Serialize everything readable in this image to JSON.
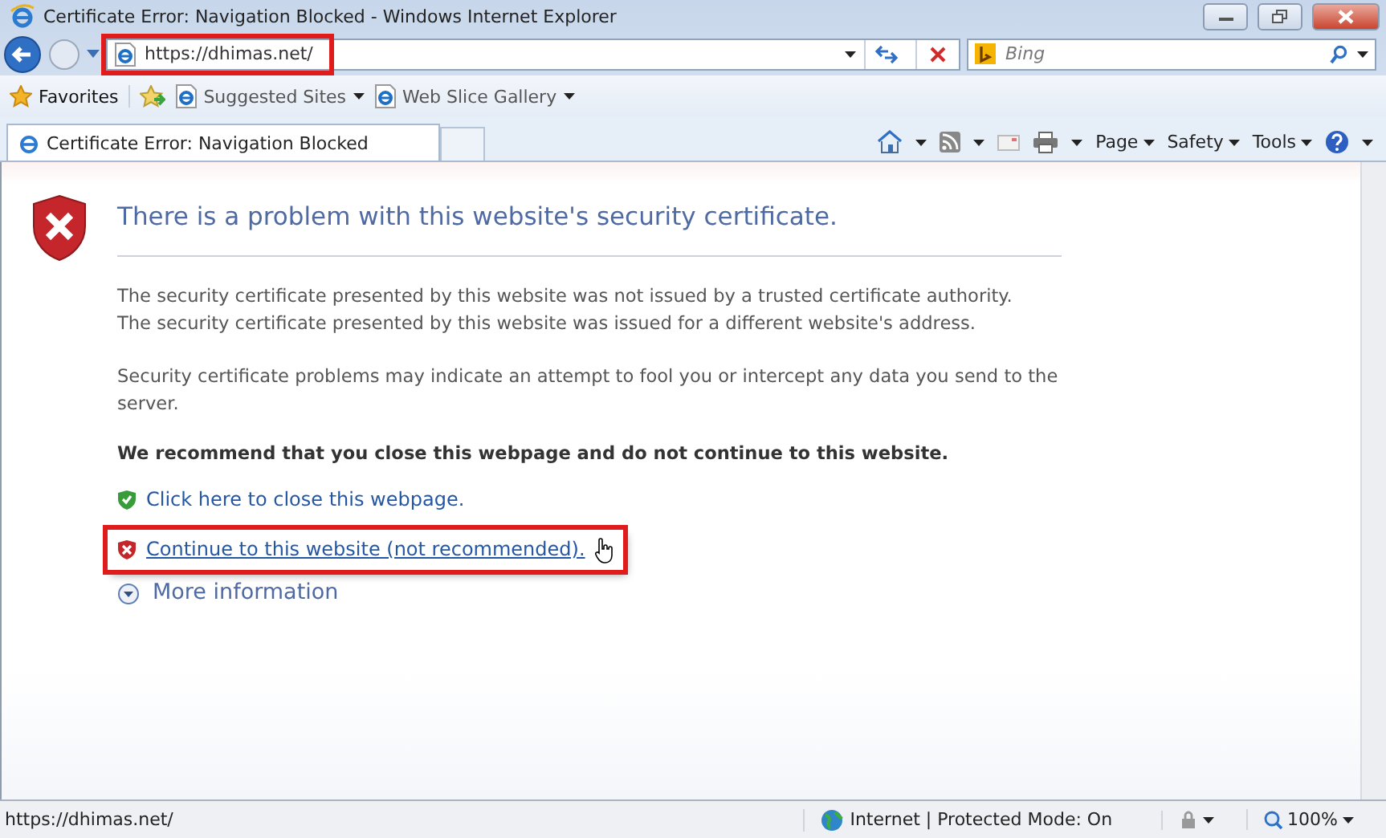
{
  "window": {
    "title": "Certificate Error: Navigation Blocked - Windows Internet Explorer"
  },
  "address_bar": {
    "value": "https://dhimas.net/",
    "highlighted": true
  },
  "search": {
    "placeholder": "Bing"
  },
  "favorites_bar": {
    "items": [
      {
        "label": "Favorites",
        "kind": "star"
      },
      {
        "label": "Suggested Sites",
        "kind": "page"
      },
      {
        "label": "Web Slice Gallery",
        "kind": "page"
      }
    ]
  },
  "tabs": [
    {
      "label": "Certificate Error: Navigation Blocked",
      "selected": true
    }
  ],
  "command_bar": {
    "menus": [
      "Page",
      "Safety",
      "Tools"
    ]
  },
  "content": {
    "heading": "There is a problem with this website's security certificate.",
    "reasons": [
      "The security certificate presented by this website was not issued by a trusted certificate authority.",
      "The security certificate presented by this website was issued for a different website's address."
    ],
    "warning": "Security certificate problems may indicate an attempt to fool you or intercept any data you send to the server.",
    "recommendation": "We recommend that you close this webpage and do not continue to this website.",
    "links": [
      {
        "label": "Click here to close this webpage.",
        "kind": "safe",
        "highlighted": false
      },
      {
        "label": "Continue to this website (not recommended).",
        "kind": "unsafe",
        "highlighted": true
      }
    ],
    "more": "More information"
  },
  "status_bar": {
    "url": "https://dhimas.net/",
    "zone": "Internet | Protected Mode: On",
    "zoom": "100%"
  }
}
